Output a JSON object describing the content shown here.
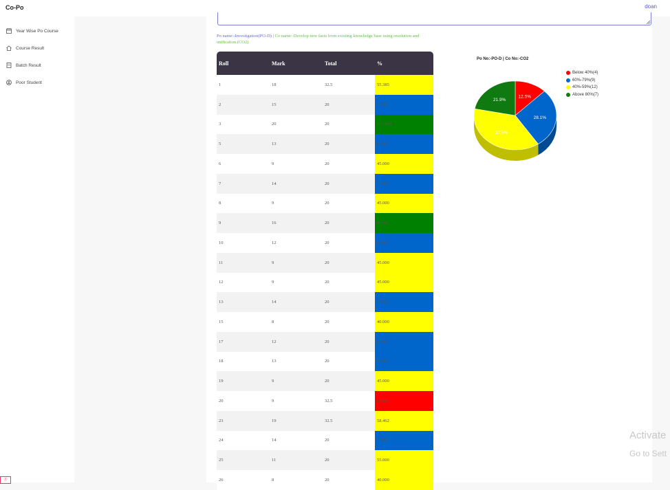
{
  "app": {
    "title": "Co-Po",
    "user": "doan"
  },
  "sidebar": {
    "items": [
      {
        "label": "Year Wise Po Course",
        "icon": "calendar-icon"
      },
      {
        "label": "Course Result",
        "icon": "home-icon"
      },
      {
        "label": "Batch Result",
        "icon": "building-icon"
      },
      {
        "label": "Poor Student",
        "icon": "user-circle-icon"
      }
    ]
  },
  "po_info": {
    "po_text": "Po name:-Investigation(PO-D) | ",
    "co_text": "Co name:-Develop new facts from existing knowledge base using resolution and unification.(CO2)"
  },
  "table": {
    "headers": [
      "Roll",
      "Mark",
      "Total",
      "%"
    ],
    "rows": [
      {
        "roll": "1",
        "mark": "18",
        "total": "32.5",
        "pct": "55.385",
        "band": "40-59"
      },
      {
        "roll": "2",
        "mark": "15",
        "total": "20",
        "pct": "75.000",
        "band": "60-79"
      },
      {
        "roll": "3",
        "mark": "20",
        "total": "20",
        "pct": "100.000",
        "band": "80+"
      },
      {
        "roll": "5",
        "mark": "13",
        "total": "20",
        "pct": "65.000",
        "band": "60-79"
      },
      {
        "roll": "6",
        "mark": "9",
        "total": "20",
        "pct": "45.000",
        "band": "40-59"
      },
      {
        "roll": "7",
        "mark": "14",
        "total": "20",
        "pct": "70.000",
        "band": "60-79"
      },
      {
        "roll": "8",
        "mark": "9",
        "total": "20",
        "pct": "45.000",
        "band": "40-59"
      },
      {
        "roll": "9",
        "mark": "16",
        "total": "20",
        "pct": "80.000",
        "band": "80+"
      },
      {
        "roll": "10",
        "mark": "12",
        "total": "20",
        "pct": "60.000",
        "band": "60-79"
      },
      {
        "roll": "11",
        "mark": "9",
        "total": "20",
        "pct": "45.000",
        "band": "40-59"
      },
      {
        "roll": "12",
        "mark": "9",
        "total": "20",
        "pct": "45.000",
        "band": "40-59"
      },
      {
        "roll": "13",
        "mark": "14",
        "total": "20",
        "pct": "70.000",
        "band": "60-79"
      },
      {
        "roll": "15",
        "mark": "8",
        "total": "20",
        "pct": "40.000",
        "band": "40-59"
      },
      {
        "roll": "17",
        "mark": "12",
        "total": "20",
        "pct": "60.000",
        "band": "60-79"
      },
      {
        "roll": "18",
        "mark": "13",
        "total": "20",
        "pct": "65.000",
        "band": "60-79"
      },
      {
        "roll": "19",
        "mark": "9",
        "total": "20",
        "pct": "45.000",
        "band": "40-59"
      },
      {
        "roll": "20",
        "mark": "9",
        "total": "32.5",
        "pct": "27.692",
        "band": "below40"
      },
      {
        "roll": "23",
        "mark": "19",
        "total": "32.5",
        "pct": "58.462",
        "band": "40-59"
      },
      {
        "roll": "24",
        "mark": "14",
        "total": "20",
        "pct": "70.000",
        "band": "60-79"
      },
      {
        "roll": "25",
        "mark": "11",
        "total": "20",
        "pct": "55.000",
        "band": "40-59"
      },
      {
        "roll": "26",
        "mark": "8",
        "total": "20",
        "pct": "40.000",
        "band": "40-59"
      }
    ]
  },
  "band_colors": {
    "below40": "#ff0000",
    "60-79": "#0066cc",
    "40-59": "#ffff00",
    "80+": "#008000"
  },
  "chart_data": {
    "type": "pie",
    "title": "Po No:-PO-D | Co No:-CO2",
    "legend_position": "right",
    "slices": [
      {
        "label": "Below 40%(4)",
        "value": 4,
        "percent_label": "12.5%",
        "color": "#ff0000",
        "side": "#b30000"
      },
      {
        "label": "60%-79%(9)",
        "value": 9,
        "percent_label": "28.1%",
        "color": "#0066cc",
        "side": "#004a94"
      },
      {
        "label": "40%-59%(12)",
        "value": 12,
        "percent_label": "37.5%",
        "color": "#ffff00",
        "side": "#bfbf00"
      },
      {
        "label": "Above 80%(7)",
        "value": 7,
        "percent_label": "21.9%",
        "color": "#0f7a0f",
        "side": "#0a560a"
      }
    ]
  },
  "watermark": {
    "line1": "Activate",
    "line2": "Go to Sett"
  },
  "corner_badge": "Ⓧ"
}
